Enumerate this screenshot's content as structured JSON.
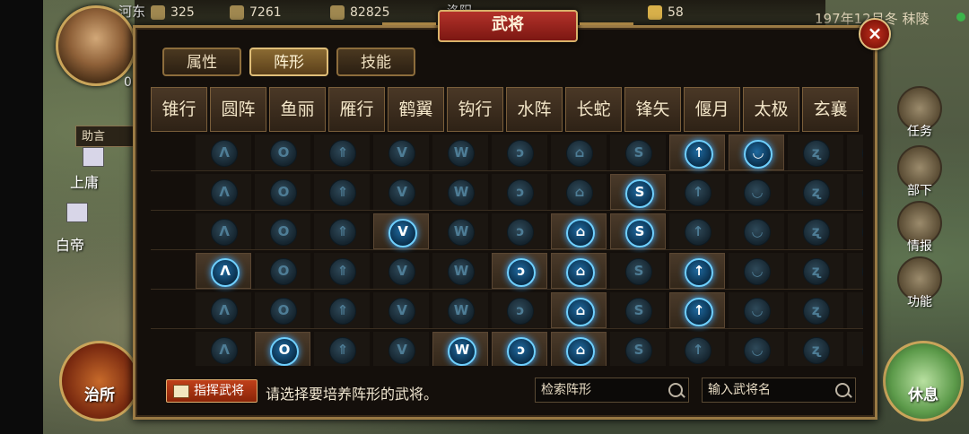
{
  "topbar": {
    "resources": [
      {
        "icon": "resource-icon",
        "value": "325"
      },
      {
        "icon": "grain-icon",
        "value": "7261"
      },
      {
        "icon": "wood-icon",
        "value": "82825"
      },
      {
        "icon": "gold-icon",
        "value": "58"
      }
    ],
    "map_label_left": "河东",
    "map_label_mid": "洛阳",
    "date": "197年12月冬 秣陵"
  },
  "left": {
    "badge": "助言",
    "place_1": "上庸",
    "place_2": "白帝",
    "avatar_digit": "0"
  },
  "panel": {
    "title": "武将",
    "close_label": "×",
    "tabs": [
      {
        "label": "属性",
        "active": false
      },
      {
        "label": "阵形",
        "active": true
      },
      {
        "label": "技能",
        "active": false
      }
    ],
    "formations": [
      "锥行",
      "圆阵",
      "鱼丽",
      "雁行",
      "鹤翼",
      "钩行",
      "水阵",
      "长蛇",
      "锋矢",
      "偃月",
      "太极",
      "玄襄"
    ],
    "gem_symbols": [
      "Λ",
      "O",
      "⇑",
      "V",
      "W",
      "ↄ",
      "⌂",
      "S",
      "↑",
      "◡",
      "ʐ",
      "·"
    ],
    "rows": [
      {
        "lit": [
          0,
          0,
          0,
          0,
          0,
          0,
          0,
          0,
          1,
          1,
          0,
          0
        ]
      },
      {
        "lit": [
          0,
          0,
          0,
          0,
          0,
          0,
          0,
          1,
          0,
          0,
          0,
          0
        ]
      },
      {
        "lit": [
          0,
          0,
          0,
          1,
          0,
          0,
          1,
          1,
          0,
          0,
          0,
          0
        ]
      },
      {
        "lit": [
          1,
          0,
          0,
          0,
          0,
          1,
          1,
          0,
          1,
          0,
          0,
          0
        ]
      },
      {
        "lit": [
          0,
          0,
          0,
          0,
          0,
          0,
          1,
          0,
          1,
          0,
          0,
          0
        ]
      },
      {
        "lit": [
          0,
          1,
          0,
          0,
          1,
          1,
          1,
          0,
          0,
          0,
          0,
          0
        ]
      }
    ],
    "bottom": {
      "command_button": "指挥武将",
      "hint": "请选择要培养阵形的武将。",
      "search_formation_placeholder": "检索阵形",
      "search_general_placeholder": "输入武将名"
    }
  },
  "side_menu": [
    {
      "label": "任务"
    },
    {
      "label": "部下"
    },
    {
      "label": "情报"
    },
    {
      "label": "功能"
    }
  ],
  "corner_buttons": {
    "left": "治所",
    "right": "休息"
  }
}
